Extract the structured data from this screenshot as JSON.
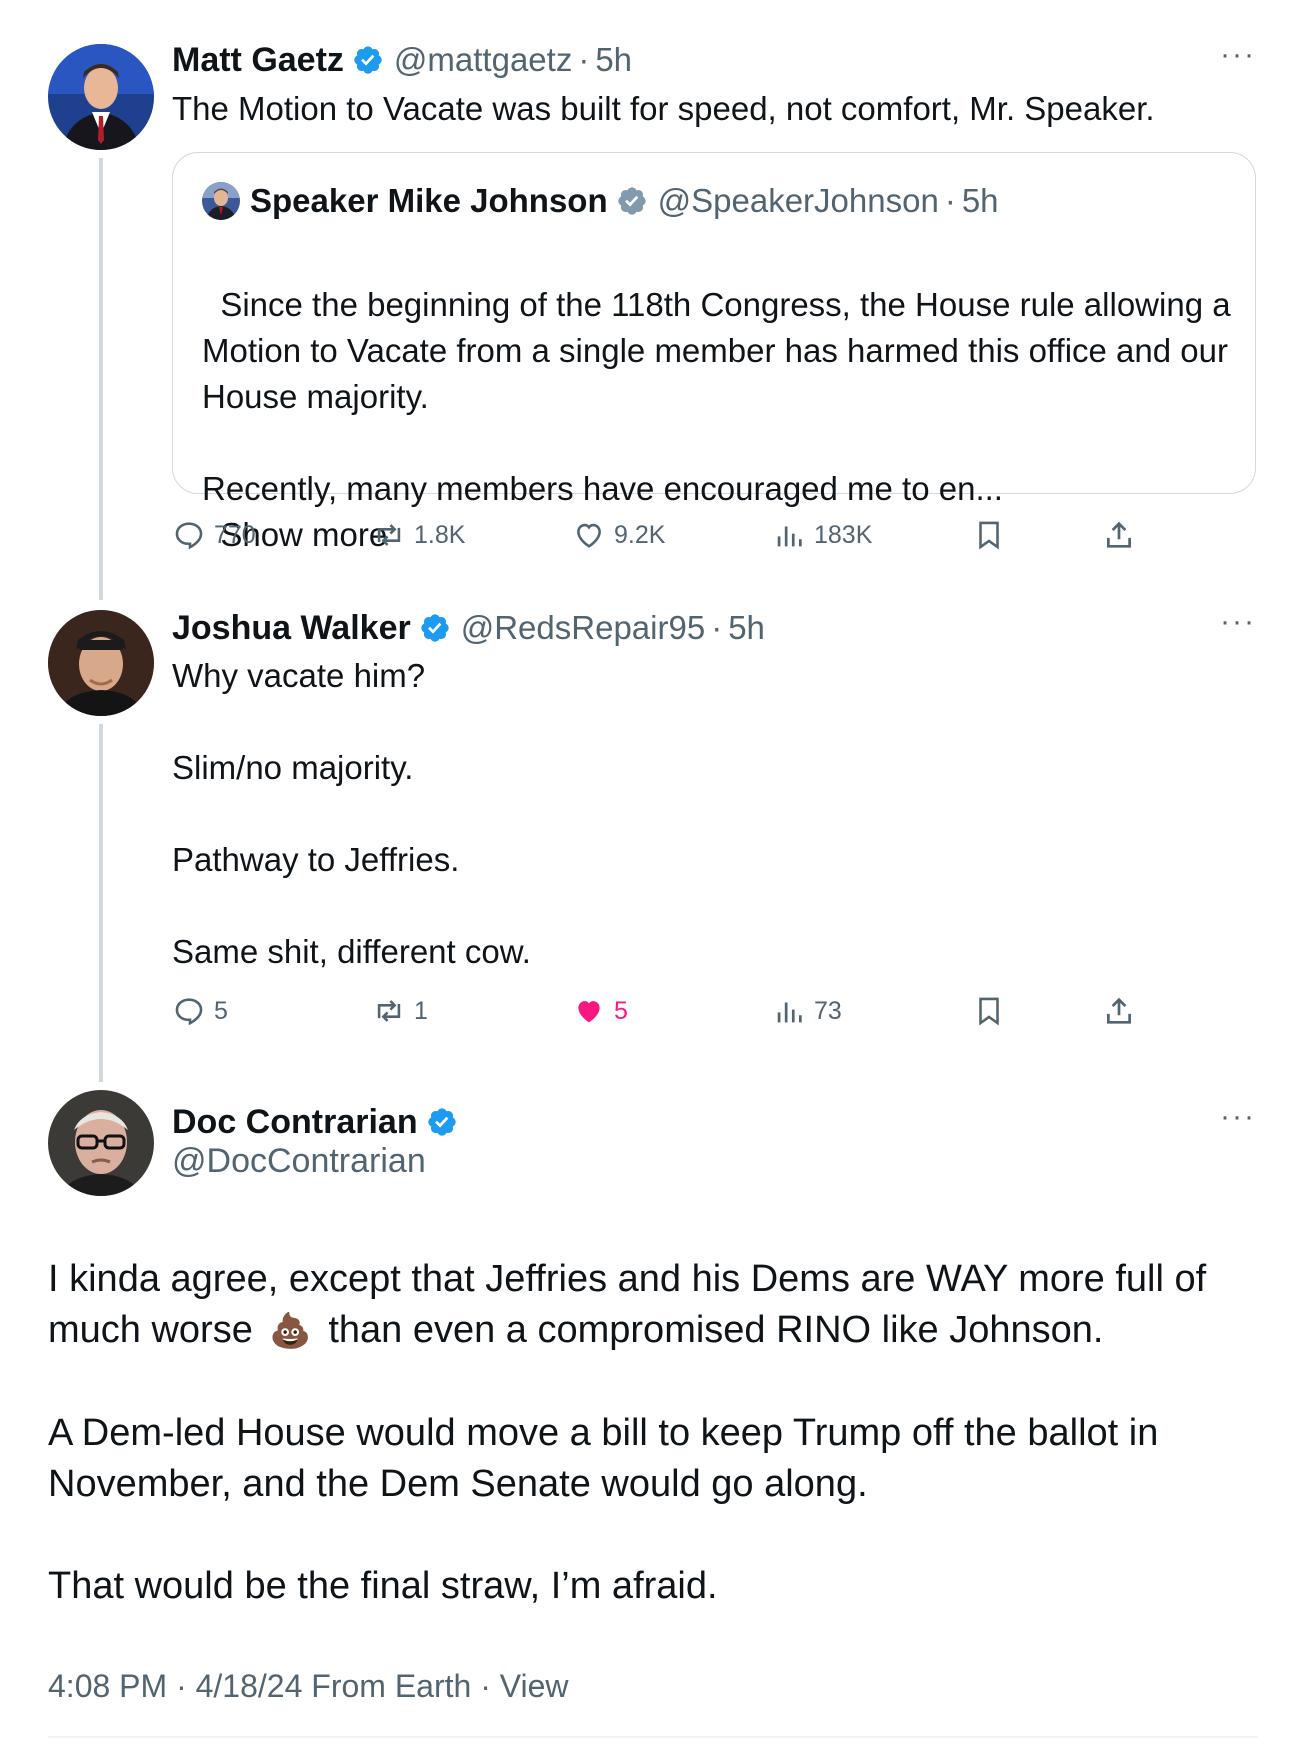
{
  "main_tweet": {
    "name": "Matt Gaetz",
    "handle": "@mattgaetz",
    "time": "5h",
    "text": "The Motion to Vacate was built for speed, not comfort, Mr. Speaker.",
    "quote": {
      "name": "Speaker Mike Johnson",
      "handle": "@SpeakerJohnson",
      "time": "5h",
      "text": "Since the beginning of the 118th Congress, the House rule allowing a Motion to Vacate from a single member has harmed this office and our House majority.\n\nRecently, many members have encouraged me to en...",
      "show_more": "Show more"
    },
    "stats": {
      "replies": "770",
      "reposts": "1.8K",
      "likes": "9.2K",
      "views": "183K"
    }
  },
  "reply_tweet": {
    "name": "Joshua Walker",
    "handle": "@RedsRepair95",
    "time": "5h",
    "text": "Why vacate him?\n\nSlim/no majority.\n\nPathway to Jeffries.\n\nSame shit, different cow.",
    "stats": {
      "replies": "5",
      "reposts": "1",
      "likes": "5",
      "views": "73"
    }
  },
  "focused_tweet": {
    "name": "Doc Contrarian",
    "handle": "@DocContrarian",
    "text_line1": "I kinda agree, except that Jeffries and his Dems are WAY more full of",
    "text_line2_a": "much worse",
    "emoji": "💩",
    "text_line2_b": "than even a compromised RINO like Johnson.",
    "text_para2": "A Dem-led House would move a bill to keep Trump off the ballot in\nNovember, and the Dem Senate would go along.",
    "text_para3": "That would be the final straw, I’m afraid.",
    "footer": "4:08 PM · 4/18/24 From Earth · View"
  },
  "more_label": "···",
  "separator": "·",
  "colors": {
    "verified": "#1d9bf0",
    "quote_verified": "#829aab",
    "like_active": "#f91880",
    "secondary": "#536471"
  }
}
